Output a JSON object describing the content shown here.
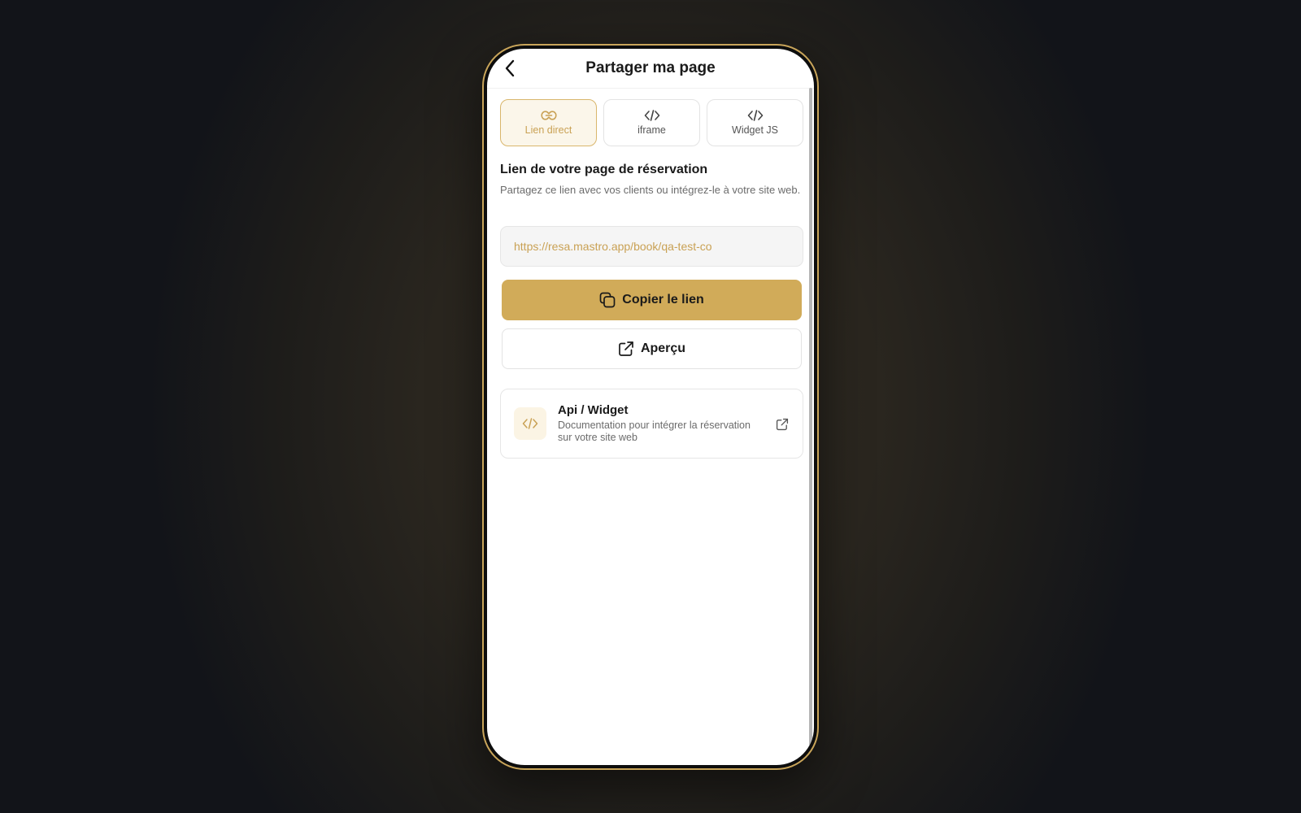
{
  "header": {
    "title": "Partager ma page",
    "back_icon": "chevron-left-icon"
  },
  "tabs": [
    {
      "label": "Lien direct",
      "icon": "link-icon",
      "active": true
    },
    {
      "label": "iframe",
      "icon": "code-icon",
      "active": false
    },
    {
      "label": "Widget JS",
      "icon": "code-icon",
      "active": false
    }
  ],
  "section": {
    "title": "Lien de votre page de réservation",
    "description": "Partagez ce lien avec vos clients ou intégrez-le à votre site web."
  },
  "link_field": {
    "value": "https://resa.mastro.app/book/qa-test-co"
  },
  "actions": {
    "copy_label": "Copier le lien",
    "preview_label": "Aperçu"
  },
  "api_card": {
    "title": "Api / Widget",
    "description": "Documentation pour intégrer la réservation sur votre site web"
  },
  "colors": {
    "accent": "#d1ab59",
    "accent_text": "#c9a154",
    "active_tab_bg": "#fbf6ea"
  }
}
